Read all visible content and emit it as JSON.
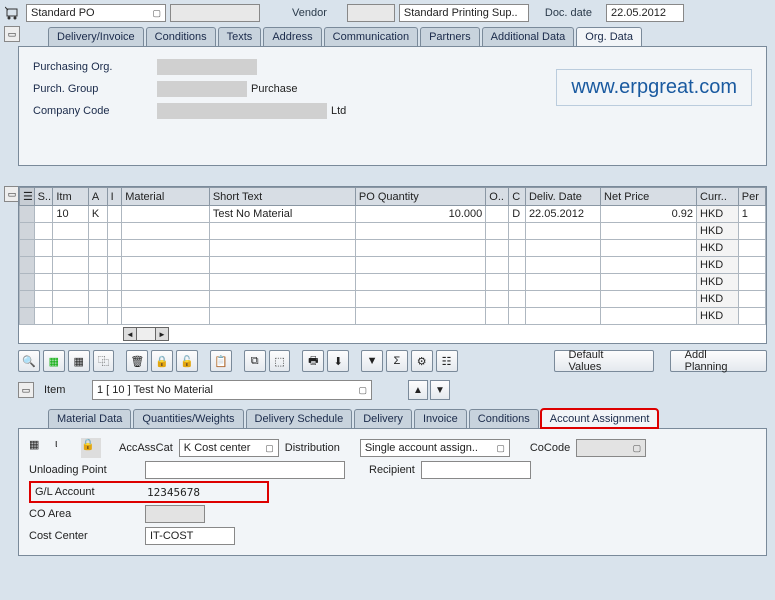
{
  "header": {
    "po_type": "Standard PO",
    "vendor_label": "Vendor",
    "vendor_value": "Standard Printing Sup..",
    "docdate_label": "Doc. date",
    "docdate_value": "22.05.2012"
  },
  "tabs_top": {
    "t0": "Delivery/Invoice",
    "t1": "Conditions",
    "t2": "Texts",
    "t3": "Address",
    "t4": "Communication",
    "t5": "Partners",
    "t6": "Additional Data",
    "t7": "Org. Data"
  },
  "org": {
    "purch_org_label": "Purchasing Org.",
    "purch_group_label": "Purch. Group",
    "purch_group_text": "Purchase",
    "company_code_label": "Company Code",
    "company_code_text": "Ltd",
    "watermark": "www.erpgreat.com"
  },
  "grid": {
    "cols": {
      "s": "S..",
      "itm": "Itm",
      "a": "A",
      "i": "I",
      "material": "Material",
      "short": "Short Text",
      "qty": "PO Quantity",
      "o": "O..",
      "c": "C",
      "deliv": "Deliv. Date",
      "net": "Net Price",
      "curr": "Curr..",
      "per": "Per"
    },
    "row1": {
      "itm": "10",
      "a": "K",
      "short": "Test No Material",
      "qty": "10.000",
      "c": "D",
      "deliv": "22.05.2012",
      "net": "0.92",
      "curr": "HKD",
      "per": "1"
    },
    "curr_default": "HKD"
  },
  "buttons": {
    "default_values": "Default Values",
    "addl_planning": "Addl Planning"
  },
  "item_detail": {
    "label": "Item",
    "value": "1 [ 10 ] Test No Material"
  },
  "tabs_bottom": {
    "b0": "Material Data",
    "b1": "Quantities/Weights",
    "b2": "Delivery Schedule",
    "b3": "Delivery",
    "b4": "Invoice",
    "b5": "Conditions",
    "b6": "Account Assignment"
  },
  "acc": {
    "accasscat_label": "AccAssCat",
    "accasscat_value": "K Cost center",
    "distribution_label": "Distribution",
    "distribution_value": "Single account assign..",
    "cocode_label": "CoCode",
    "unloading_label": "Unloading Point",
    "recipient_label": "Recipient",
    "gl_label": "G/L Account",
    "gl_value": "12345678",
    "coarea_label": "CO Area",
    "costcenter_label": "Cost Center",
    "costcenter_value": "IT-COST"
  }
}
